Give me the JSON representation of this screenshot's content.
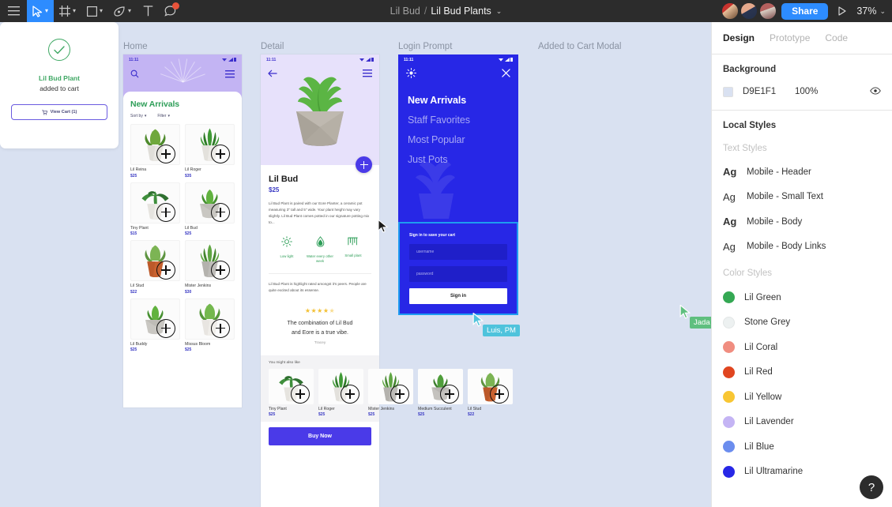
{
  "toolbar": {
    "tools": [
      {
        "name": "main-menu",
        "icon": "hamburger-icon",
        "selected": false,
        "caret": false
      },
      {
        "name": "move-tool",
        "icon": "cursor-icon",
        "selected": true,
        "caret": true
      },
      {
        "name": "frame-tool",
        "icon": "frame-icon",
        "selected": false,
        "caret": true
      },
      {
        "name": "shape-tool",
        "icon": "square-icon",
        "selected": false,
        "caret": true
      },
      {
        "name": "pen-tool",
        "icon": "pen-icon",
        "selected": false,
        "caret": true
      },
      {
        "name": "text-tool",
        "icon": "text-icon",
        "selected": false,
        "caret": false
      },
      {
        "name": "comment-tool",
        "icon": "comment-icon",
        "selected": false,
        "caret": false
      }
    ],
    "breadcrumb": {
      "project": "Lil Bud",
      "separator": "/",
      "file": "Lil Bud Plants",
      "caret": "⌄"
    },
    "share_label": "Share",
    "zoom_label": "37%",
    "zoom_caret": "⌄",
    "avatars": [
      "avatar-1",
      "avatar-2",
      "avatar-3"
    ]
  },
  "panel": {
    "tabs": [
      {
        "label": "Design",
        "selected": true
      },
      {
        "label": "Prototype",
        "selected": false
      },
      {
        "label": "Code",
        "selected": false
      }
    ],
    "background": {
      "title": "Background",
      "hex": "D9E1F1",
      "opacity": "100%",
      "color": "#D9E1F1"
    },
    "local_styles_title": "Local Styles",
    "text_styles_label": "Text Styles",
    "text_styles": [
      {
        "preview": "Ag",
        "bold": true,
        "label": "Mobile - Header"
      },
      {
        "preview": "Ag",
        "bold": false,
        "label": "Mobile - Small Text"
      },
      {
        "preview": "Ag",
        "bold": true,
        "label": "Mobile - Body"
      },
      {
        "preview": "Ag",
        "bold": false,
        "label": "Mobile - Body Links"
      }
    ],
    "color_styles_label": "Color Styles",
    "color_styles": [
      {
        "label": "Lil Green",
        "color": "#34A853"
      },
      {
        "label": "Stone Grey",
        "color": "#EDF1F1"
      },
      {
        "label": "Lil Coral",
        "color": "#F08D80"
      },
      {
        "label": "Lil Red",
        "color": "#E04520"
      },
      {
        "label": "Lil Yellow",
        "color": "#F8C633"
      },
      {
        "label": "Lil Lavender",
        "color": "#C4B4F4"
      },
      {
        "label": "Lil Blue",
        "color": "#6B8DEE"
      },
      {
        "label": "Lil Ultramarine",
        "color": "#2727E6"
      }
    ],
    "help_label": "?"
  },
  "canvas": {
    "frames": {
      "home": {
        "label": "Home",
        "status_time": "11:11",
        "title": "New Arrivals",
        "filters": [
          {
            "label": "Sort by",
            "caret": "▾"
          },
          {
            "label": "Filter",
            "caret": "▾"
          }
        ],
        "products": [
          {
            "name": "Lil Reina",
            "price": "$25",
            "plant": "bushy-white-pot"
          },
          {
            "name": "Lil Roger",
            "price": "$35",
            "plant": "spiky-white-pot"
          },
          {
            "name": "Tiny Plant",
            "price": "$15",
            "plant": "fern-white-pot"
          },
          {
            "name": "Lil Bud",
            "price": "$25",
            "plant": "bud-grey-pot"
          },
          {
            "name": "Lil Stud",
            "price": "$22",
            "plant": "succulent-terracotta"
          },
          {
            "name": "Mister Jenkins",
            "price": "$30",
            "plant": "spider-grey-pot"
          },
          {
            "name": "Lil Buddy",
            "price": "$25",
            "plant": "bud-grey-pot"
          },
          {
            "name": "Missus Bloom",
            "price": "$25",
            "plant": "leafy-white-pot"
          }
        ]
      },
      "detail": {
        "label": "Detail",
        "status_time": "11:11",
        "product_name": "Lil Bud",
        "price": "$25",
        "description": "Lil Bud Plant is paired with our Eore Planter, a ceramic pot measuring 3\" tall and 5\" wide. Your plant height may vary slightly. Lil Bud Plant comes potted in our signature potting mix to...",
        "care": [
          {
            "icon": "sun-icon",
            "label": "Low light"
          },
          {
            "icon": "droplet-icon",
            "label": "Water every other week"
          },
          {
            "icon": "ruler-icon",
            "label": "Small plant"
          }
        ],
        "review_intro": "Lil Bud Plant is highlight rated amongst it's peers. People are quite excited about its essense.",
        "stars": "★★★★",
        "half_star": "★",
        "quote_line1": "The combination of Lil Bud",
        "quote_line2": "and Eore is a true vibe.",
        "quote_author": "Tracey",
        "also_title": "You might also like",
        "also_products": [
          {
            "name": "Tiny Plant",
            "price": "$25",
            "plant": "fern-white-pot"
          },
          {
            "name": "Lil Roger",
            "price": "$25",
            "plant": "spiky-white-pot"
          },
          {
            "name": "Mister Jenkins",
            "price": "$25",
            "plant": "spider-grey-pot"
          },
          {
            "name": "Medium Succulent",
            "price": "$25",
            "plant": "succulent-grey-pot"
          },
          {
            "name": "Lil Stud",
            "price": "$22",
            "plant": "succulent-terracotta"
          }
        ],
        "buy_label": "Buy Now"
      },
      "login": {
        "label": "Login Prompt",
        "status_time": "11:11",
        "menu_items": [
          {
            "label": "New Arrivals",
            "current": true
          },
          {
            "label": "Staff Favorites",
            "current": false
          },
          {
            "label": "Most Popular",
            "current": false
          },
          {
            "label": "Just Pots",
            "current": false
          }
        ],
        "signin_title": "Sign in to save your cart",
        "username_placeholder": "username",
        "password_placeholder": "password",
        "submit_label": "Sign in"
      },
      "cart": {
        "label": "Added to Cart Modal",
        "product": "Lil Bud Plant",
        "message": "added to cart",
        "button_label": "View Cart (1)"
      }
    },
    "cursors": [
      {
        "name": "luis-cursor",
        "label": "Luis, PM",
        "color": "#4FC3DC"
      },
      {
        "name": "jada-cursor",
        "label": "Jada",
        "color": "#5FBF7F"
      },
      {
        "name": "local-cursor",
        "label": "",
        "color": "#111111"
      }
    ]
  }
}
